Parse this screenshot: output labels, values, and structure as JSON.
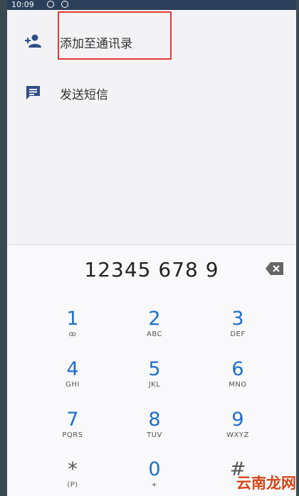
{
  "status_bar": {
    "time": "10:09"
  },
  "menu": {
    "items": [
      {
        "label": "添加至通讯录",
        "icon": "add-person-icon"
      },
      {
        "label": "发送短信",
        "icon": "message-icon"
      }
    ]
  },
  "dialer": {
    "number": "12345 678 9",
    "keys": [
      {
        "digit": "1",
        "letters": "ꝏ"
      },
      {
        "digit": "2",
        "letters": "ABC"
      },
      {
        "digit": "3",
        "letters": "DEF"
      },
      {
        "digit": "4",
        "letters": "GHI"
      },
      {
        "digit": "5",
        "letters": "JKL"
      },
      {
        "digit": "6",
        "letters": "MNO"
      },
      {
        "digit": "7",
        "letters": "PQRS"
      },
      {
        "digit": "8",
        "letters": "TUV"
      },
      {
        "digit": "9",
        "letters": "WXYZ"
      },
      {
        "digit": "*",
        "letters": "(P)"
      },
      {
        "digit": "0",
        "letters": "+"
      },
      {
        "digit": "#",
        "letters": ""
      }
    ]
  },
  "watermark": "云南龙网",
  "colors": {
    "accent": "#1e6fcc",
    "highlight_box": "#e53935",
    "icon": "#2f4f86"
  }
}
